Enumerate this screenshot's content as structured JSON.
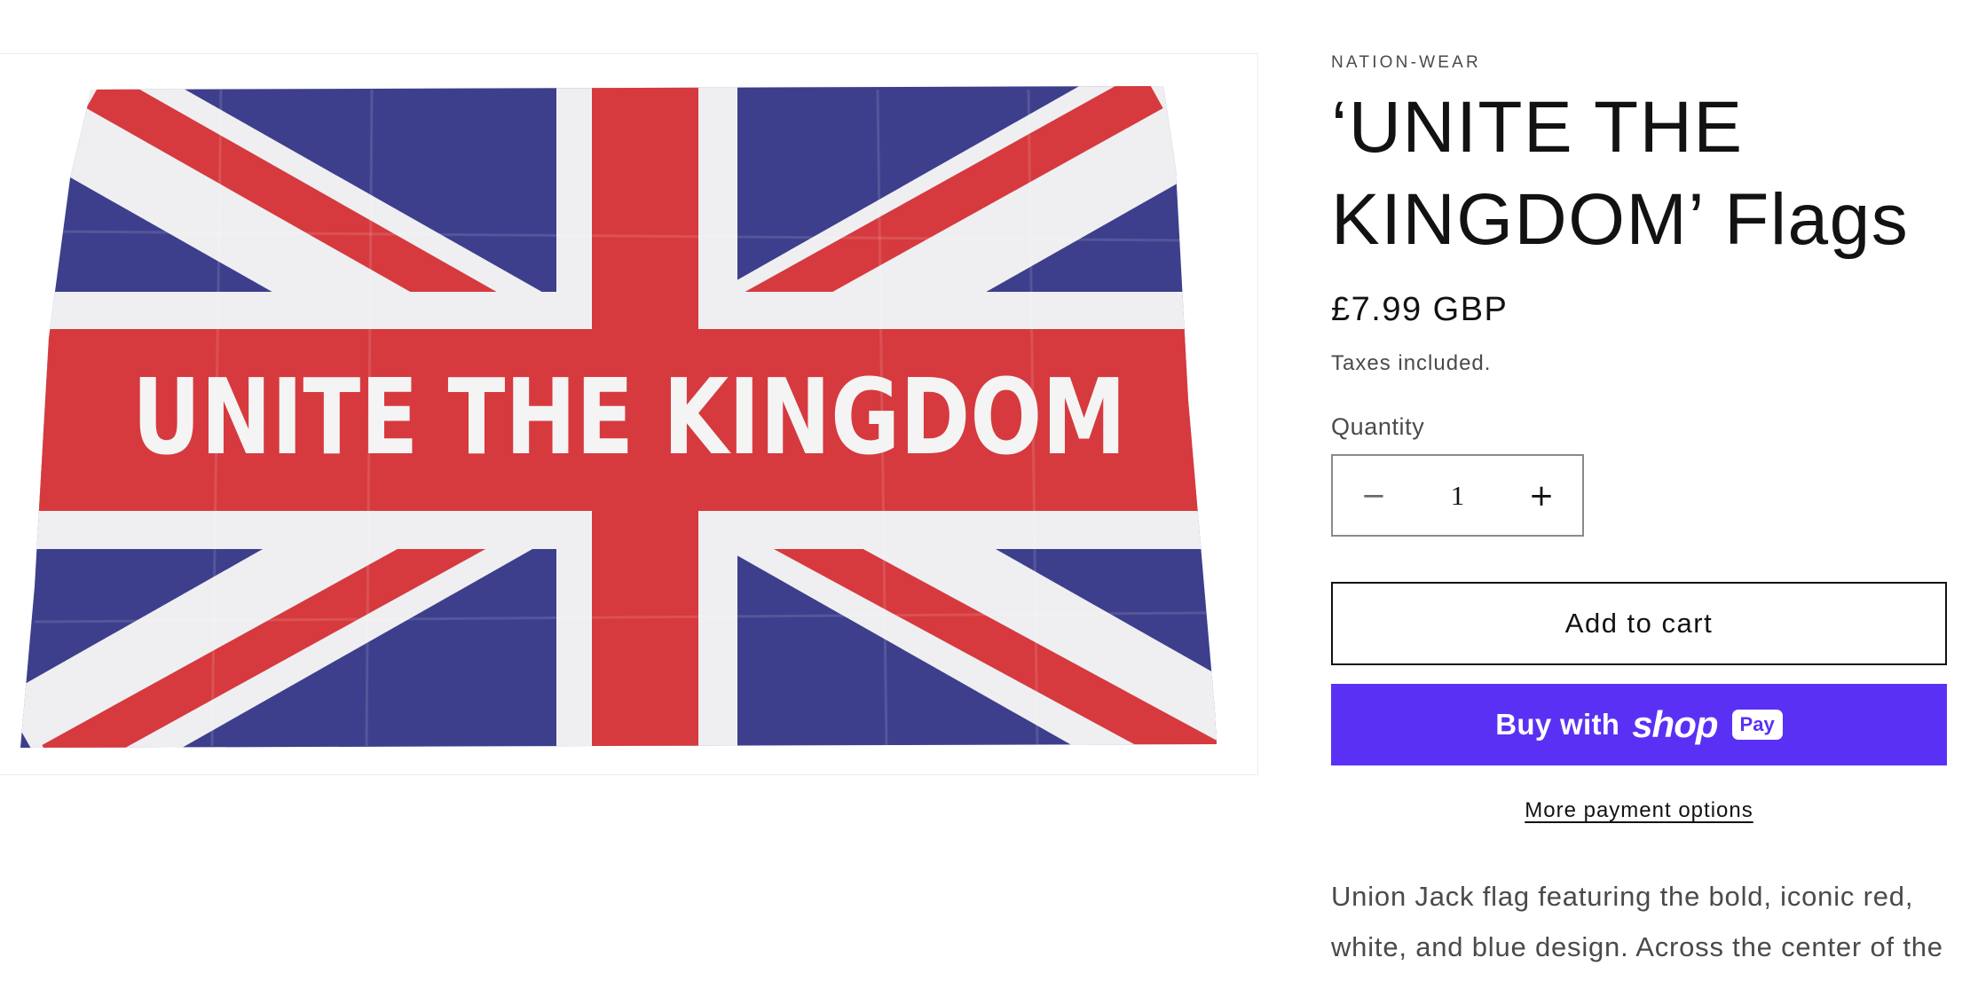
{
  "product": {
    "vendor": "NATION-WEAR",
    "title": "‘UNITE THE KINGDOM’ Flags",
    "price": "£7.99 GBP",
    "tax_note": "Taxes included.",
    "quantity_label": "Quantity",
    "quantity_value": "1",
    "decrease_symbol": "−",
    "increase_symbol": "+",
    "add_to_cart_label": "Add to cart",
    "buy_with_label": "Buy with",
    "shop_brand": "shop",
    "pay_badge": "Pay",
    "more_payment_label": "More payment options",
    "description": "Union Jack flag featuring the bold, iconic red, white, and blue design. Across the center of the"
  },
  "image": {
    "banner_text": "UNITE THE KINGDOM"
  },
  "colors": {
    "flag_blue": "#3d3f8c",
    "flag_red": "#d63a3e",
    "flag_white": "#efeff2",
    "shop_pay_purple": "#5a31f4",
    "text_primary": "#121212",
    "text_secondary": "#4a4a4a"
  }
}
